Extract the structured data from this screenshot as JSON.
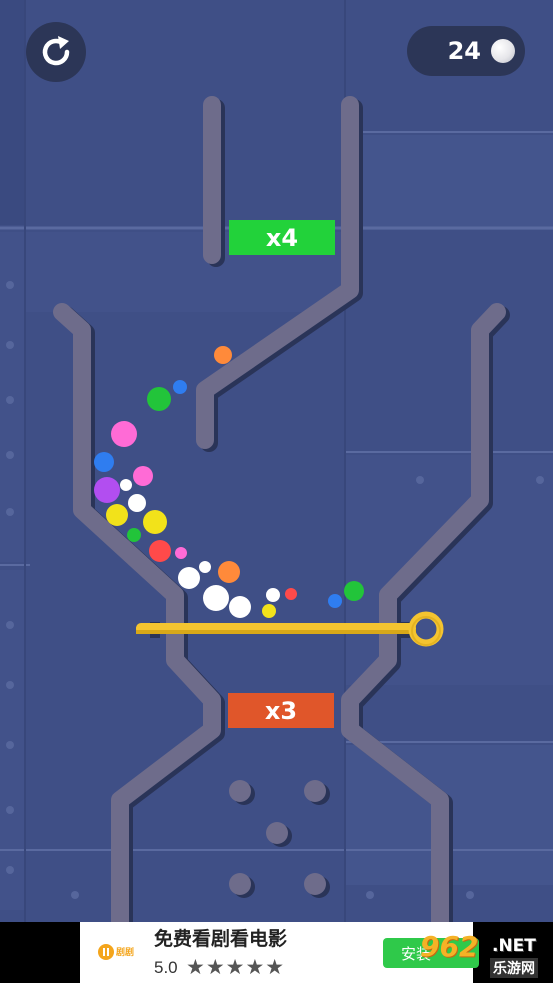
{
  "hud": {
    "restart_icon": "restart-icon",
    "ball_count": "24",
    "ball_icon": "white-ball-icon"
  },
  "multipliers": {
    "top": {
      "label": "x4",
      "color": "#22d23a"
    },
    "middle": {
      "label": "x3",
      "color": "#e0562a"
    }
  },
  "pin": {
    "color": "#f4c430",
    "icon": "pull-pin-ring"
  },
  "balls": {
    "colors": [
      "#ff8a3a",
      "#2f7df0",
      "#22c43a",
      "#ff6bd6",
      "#b24ef0",
      "#f2e21a",
      "#ffffff",
      "#ff4a4a"
    ]
  },
  "ad": {
    "logo_text": "剧剧",
    "title": "免费看剧看电影",
    "rating": "5.0",
    "stars": "★★★★★",
    "install_label": "安装"
  },
  "watermark": {
    "number": "962",
    "net": ".NET",
    "sub": "乐游网"
  }
}
